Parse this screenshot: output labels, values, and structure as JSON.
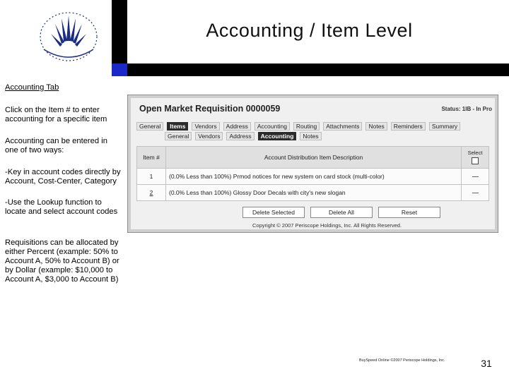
{
  "slide": {
    "title": "Accounting / Item Level",
    "page_number": "31",
    "footer": "BuySpeed Online ©2007 Periscope Holdings, Inc.",
    "logo_text": "SHELBY COUNTY AIRPORT AUTHORITY"
  },
  "left_text": {
    "heading": "Accounting Tab",
    "p1": "Click on the Item # to enter accounting for a specific item",
    "p2": "Accounting can be entered in one of two ways:",
    "p3": "-Key in account codes directly by Account, Cost-Center, Category",
    "p4": "-Use the Lookup function to locate and select account codes",
    "p5": "Requisitions can be allocated by either Percent (example: 50% to Account A, 50% to Account B) or by Dollar (example: $10,000 to Account A, $3,000 to Account B)"
  },
  "screenshot": {
    "title": "Open Market Requisition 0000059",
    "status": "Status: 1IB - In Pro",
    "tabs_row1": [
      "General",
      "Items",
      "Vendors",
      "Address",
      "Accounting",
      "Routing",
      "Attachments",
      "Notes",
      "Reminders",
      "Summary"
    ],
    "tabs_row2": [
      "General",
      "Vendors",
      "Address",
      "Accounting",
      "Notes"
    ],
    "table": {
      "headers": {
        "item": "Item #",
        "description": "Account Distribution Item Description",
        "select": "Select"
      },
      "rows": [
        {
          "item": "1",
          "description": "(0.0%  Less than 100%) Prmod notices for new system on card stock (multi-color)"
        },
        {
          "item": "2",
          "description": "(0.0%  Less than 100%) Glossy Door Decals with city's new slogan"
        }
      ]
    },
    "buttons": [
      "Delete Selected",
      "Delete All",
      "Reset"
    ],
    "copyright": "Copyright © 2007 Periscope Holdings, Inc.  All Rights Reserved."
  }
}
